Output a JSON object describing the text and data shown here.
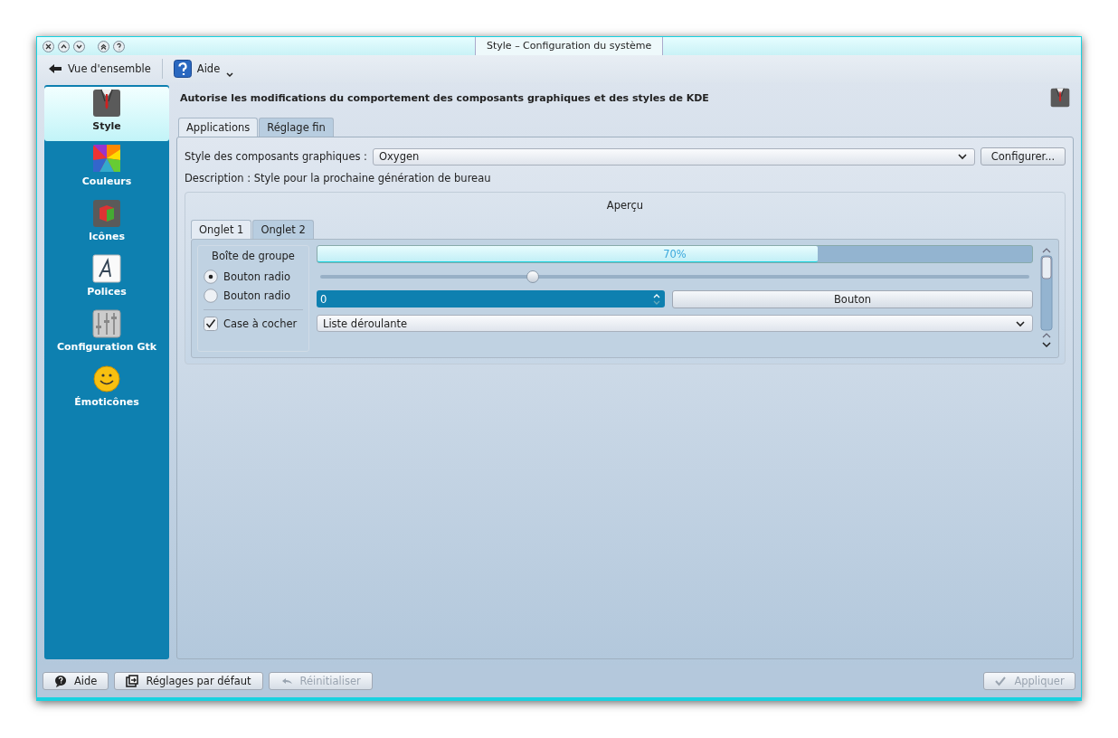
{
  "window": {
    "title": "Style – Configuration du système"
  },
  "toolbar": {
    "back": "Vue d'ensemble",
    "help": "Aide"
  },
  "sidebar": {
    "items": [
      {
        "label": "Style",
        "selected": true
      },
      {
        "label": "Couleurs",
        "selected": false
      },
      {
        "label": "Icônes",
        "selected": false
      },
      {
        "label": "Polices",
        "selected": false
      },
      {
        "label": "Configuration Gtk",
        "selected": false
      },
      {
        "label": "Émoticônes",
        "selected": false
      }
    ]
  },
  "header": "Autorise les modifications du comportement des composants graphiques et des styles de KDE",
  "tabs": [
    {
      "label": "Applications",
      "selected": true
    },
    {
      "label": "Réglage fin",
      "selected": false
    }
  ],
  "style_row": {
    "label": "Style des composants graphiques :",
    "value": "Oxygen",
    "button": "Configurer..."
  },
  "description": "Description : Style pour la prochaine génération de bureau",
  "preview": {
    "title": "Aperçu",
    "tabs": [
      {
        "label": "Onglet 1",
        "selected": true
      },
      {
        "label": "Onglet 2",
        "selected": false
      }
    ],
    "group_box": {
      "title": "Boîte de groupe",
      "radios": [
        {
          "label": "Bouton radio",
          "selected": true
        },
        {
          "label": "Bouton radio",
          "selected": false
        }
      ],
      "checkbox": {
        "label": "Case à cocher",
        "checked": true
      }
    },
    "progress": {
      "level": 0.7,
      "reading": "70%"
    },
    "slider": {
      "level": 0.3
    },
    "spinbox": {
      "value": "0"
    },
    "button": "Bouton",
    "combo": "Liste déroulante"
  },
  "footer": {
    "buttons": [
      {
        "label": "Aide",
        "disabled": false
      },
      {
        "label": "Réglages par défaut",
        "disabled": false
      },
      {
        "label": "Réinitialiser",
        "disabled": true
      }
    ],
    "apply": {
      "label": "Appliquer",
      "disabled": true
    }
  }
}
